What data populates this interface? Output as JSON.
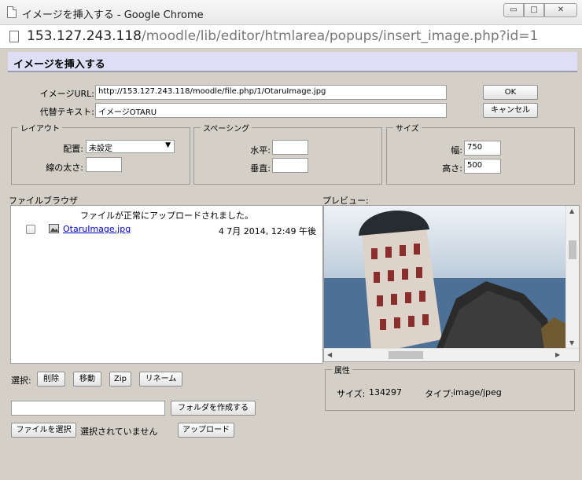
{
  "window": {
    "title": "イメージを挿入する - Google Chrome",
    "min": "▭",
    "max": "□",
    "close": "✕"
  },
  "address": {
    "host": "153.127.243.118",
    "path": "/moodle/lib/editor/htmlarea/popups/insert_image.php?id=1"
  },
  "dialog": {
    "heading": "イメージを挿入する"
  },
  "form": {
    "url_label": "イメージURL:",
    "url_value": "http://153.127.243.118/moodle/file.php/1/OtaruImage.jpg",
    "alt_label": "代替テキスト:",
    "alt_value": "イメージOTARU",
    "ok_label": "OK",
    "cancel_label": "キャンセル"
  },
  "layout": {
    "legend": "レイアウト",
    "align_label": "配置:",
    "align_value": "未設定",
    "border_label": "線の太さ:",
    "border_value": ""
  },
  "spacing": {
    "legend": "スペーシング",
    "h_label": "水平:",
    "h_value": "",
    "v_label": "垂直:",
    "v_value": ""
  },
  "size": {
    "legend": "サイズ",
    "width_label": "幅:",
    "width_value": "750",
    "height_label": "高さ:",
    "height_value": "500"
  },
  "browser": {
    "label": "ファイルブラウザ",
    "message": "ファイルが正常にアップロードされました。",
    "files": [
      {
        "name": "OtaruImage.jpg",
        "date": "4 7月 2014, 12:49 午後"
      }
    ]
  },
  "preview": {
    "label": "プレビュー:"
  },
  "actions": {
    "select_label": "選択:",
    "delete_label": "削除",
    "move_label": "移動",
    "zip_label": "Zip",
    "rename_label": "リネーム"
  },
  "attributes": {
    "legend": "属性",
    "size_label": "サイズ:",
    "size_value": "134297",
    "type_label": "タイプ:",
    "type_value": "image/jpeg"
  },
  "folder": {
    "input_value": "",
    "create_label": "フォルダを作成する"
  },
  "upload": {
    "choose_label": "ファイルを選択",
    "no_file_label": "選択されていません",
    "upload_label": "アップロード"
  },
  "icons": {
    "page": "page-icon",
    "image_file": "image-file-icon",
    "select_arrow": "▼",
    "up": "▲",
    "down": "▼",
    "left": "◀",
    "right": "▶"
  }
}
